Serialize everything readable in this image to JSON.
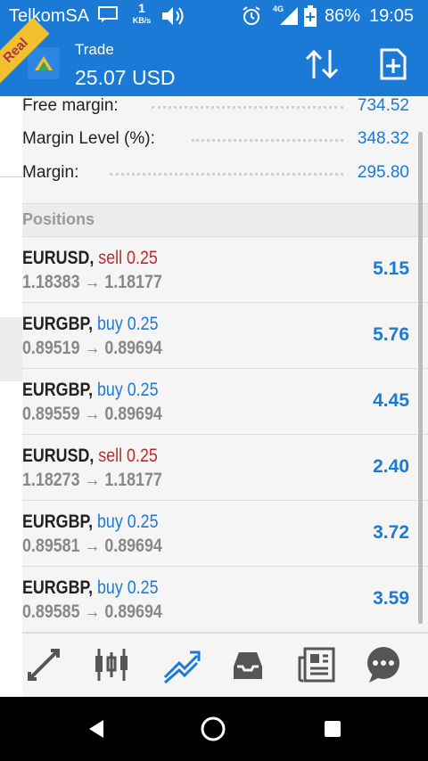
{
  "status_bar": {
    "carrier": "TelkomSA",
    "speed_value": "1",
    "speed_unit": "KB/s",
    "network": "4G",
    "battery": "86%",
    "time": "19:05"
  },
  "app_bar": {
    "title": "Trade",
    "balance": "25.07 USD",
    "ribbon_text": "Real"
  },
  "summary": [
    {
      "label": "Free margin:",
      "value": "734.52"
    },
    {
      "label": "Margin Level (%):",
      "value": "348.32"
    },
    {
      "label": "Margin:",
      "value": "295.80"
    }
  ],
  "positions_header": "Positions",
  "positions": [
    {
      "symbol": "EURUSD,",
      "side": "sell",
      "volume": "0.25",
      "open": "1.18383",
      "arrow": "→",
      "current": "1.18177",
      "profit": "5.15"
    },
    {
      "symbol": "EURGBP,",
      "side": "buy",
      "volume": "0.25",
      "open": "0.89519",
      "arrow": "→",
      "current": "0.89694",
      "profit": "5.76"
    },
    {
      "symbol": "EURGBP,",
      "side": "buy",
      "volume": "0.25",
      "open": "0.89559",
      "arrow": "→",
      "current": "0.89694",
      "profit": "4.45"
    },
    {
      "symbol": "EURUSD,",
      "side": "sell",
      "volume": "0.25",
      "open": "1.18273",
      "arrow": "→",
      "current": "1.18177",
      "profit": "2.40"
    },
    {
      "symbol": "EURGBP,",
      "side": "buy",
      "volume": "0.25",
      "open": "0.89581",
      "arrow": "→",
      "current": "0.89694",
      "profit": "3.72"
    },
    {
      "symbol": "EURGBP,",
      "side": "buy",
      "volume": "0.25",
      "open": "0.89585",
      "arrow": "→",
      "current": "0.89694",
      "profit": "3.59"
    }
  ],
  "bottom_nav": [
    "quotes-icon",
    "chart-icon",
    "trade-icon",
    "history-icon",
    "news-icon",
    "chat-icon"
  ],
  "colors": {
    "accent": "#1a7ad6",
    "sell": "#c0282d",
    "ribbon": "#f2c12e"
  }
}
